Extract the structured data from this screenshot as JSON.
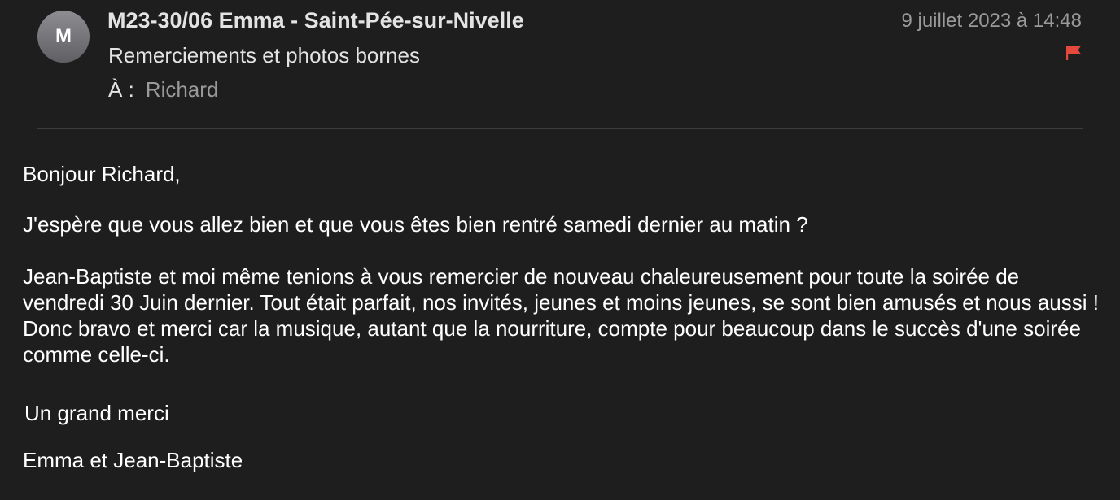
{
  "header": {
    "avatar_initial": "M",
    "sender": "M23-30/06 Emma - Saint-Pée-sur-Nivelle",
    "subject": "Remerciements et photos bornes",
    "to_label": "À :",
    "to_name": "Richard",
    "date": "9 juillet 2023 à 14:48",
    "flag_icon": "flag-icon",
    "flag_color": "#e5483d"
  },
  "message": {
    "greeting": "Bonjour Richard,",
    "paragraph1": "J'espère que vous allez bien et que vous êtes bien rentré samedi dernier au matin ?",
    "paragraph2": "Jean-Baptiste et moi même tenions à vous remercier de nouveau chaleureusement pour toute la soirée de vendredi 30 Juin dernier. Tout était parfait, nos invités, jeunes et moins jeunes, se sont bien amusés et nous aussi ! Donc bravo et merci car la musique, autant que la nourriture, compte pour beaucoup dans le succès d'une soirée comme celle-ci.",
    "closing": "Un grand merci",
    "signature": "Emma et Jean-Baptiste"
  }
}
